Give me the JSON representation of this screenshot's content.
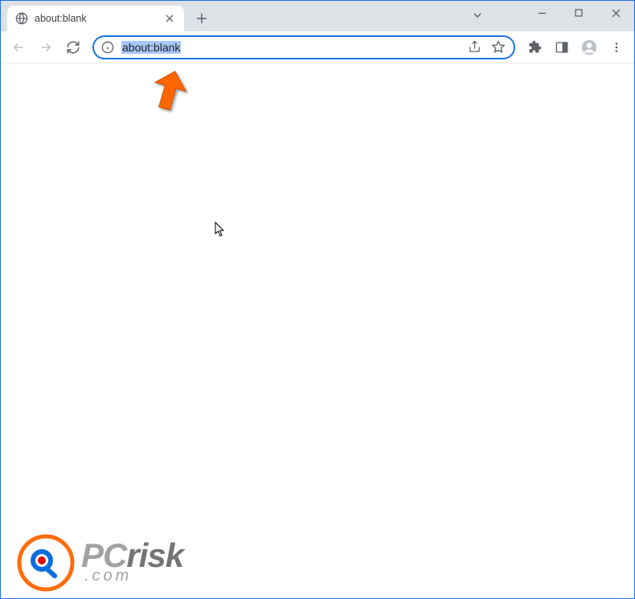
{
  "tab": {
    "title": "about:blank"
  },
  "omnibox": {
    "url": "about:blank"
  },
  "watermark": {
    "brand_pc": "PC",
    "brand_risk": "risk",
    "brand_dotcom": ".com"
  },
  "colors": {
    "accent": "#1a73e8",
    "orange_arrow": "#ff6600",
    "selection": "#a8c7fa"
  }
}
